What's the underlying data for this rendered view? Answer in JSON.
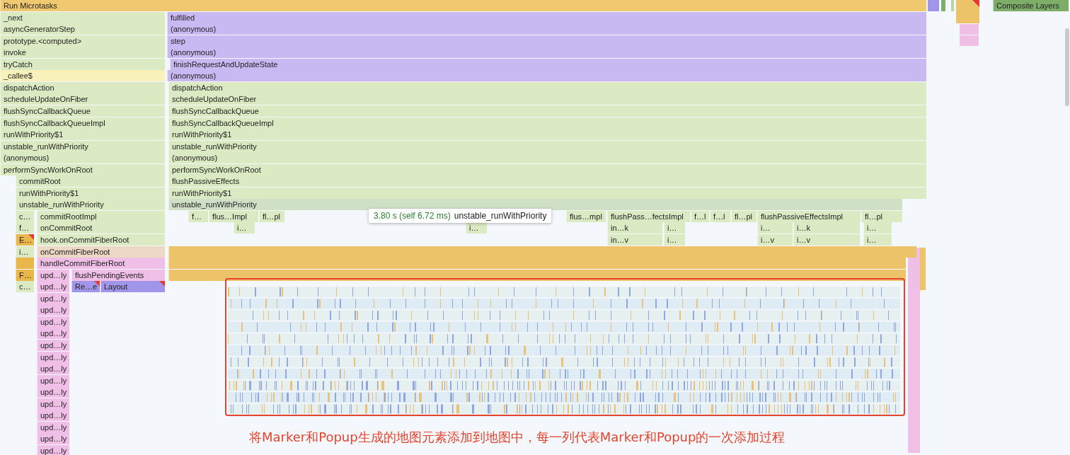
{
  "flame_chart": {
    "rows": [
      {
        "events": [
          {
            "label": "Run Microtasks",
            "color": "#f0c870",
            "warning": false
          },
          {
            "label": "Composite Layers",
            "color": "#7dad68",
            "warning": false
          }
        ]
      },
      {
        "events": [
          {
            "label": "_next",
            "color": "#dbeac2",
            "warning": false
          },
          {
            "label": "fulfilled",
            "color": "#c8b9f2",
            "warning": false
          }
        ]
      },
      {
        "events": [
          {
            "label": "asyncGeneratorStep",
            "color": "#dbeac2",
            "warning": false
          },
          {
            "label": "(anonymous)",
            "color": "#c8b9f2",
            "warning": false
          }
        ]
      },
      {
        "events": [
          {
            "label": "prototype.<computed>",
            "color": "#dbeac2",
            "warning": false
          },
          {
            "label": "step",
            "color": "#c8b9f2",
            "warning": false
          }
        ]
      },
      {
        "events": [
          {
            "label": "invoke",
            "color": "#dbeac2",
            "warning": false
          },
          {
            "label": "(anonymous)",
            "color": "#c8b9f2",
            "warning": false
          }
        ]
      },
      {
        "events": [
          {
            "label": "tryCatch",
            "color": "#dbeac2",
            "warning": false
          },
          {
            "label": "finishRequestAndUpdateState",
            "color": "#c8b9f2",
            "warning": false
          }
        ]
      },
      {
        "events": [
          {
            "label": "_callee$",
            "color": "#f8f1ba",
            "warning": false
          },
          {
            "label": "(anonymous)",
            "color": "#c8b9f2",
            "warning": false
          }
        ]
      },
      {
        "events": [
          {
            "label": "dispatchAction",
            "color": "#dbeac2",
            "warning": false
          },
          {
            "label": "dispatchAction",
            "color": "#dbeac2",
            "warning": false
          }
        ]
      },
      {
        "events": [
          {
            "label": "scheduleUpdateOnFiber",
            "color": "#dbeac2",
            "warning": false
          },
          {
            "label": "scheduleUpdateOnFiber",
            "color": "#dbeac2",
            "warning": false
          }
        ]
      },
      {
        "events": [
          {
            "label": "flushSyncCallbackQueue",
            "color": "#dbeac2",
            "warning": false
          },
          {
            "label": "flushSyncCallbackQueue",
            "color": "#dbeac2",
            "warning": false
          }
        ]
      },
      {
        "events": [
          {
            "label": "flushSyncCallbackQueueImpl",
            "color": "#dbeac2",
            "warning": false
          },
          {
            "label": "flushSyncCallbackQueueImpl",
            "color": "#dbeac2",
            "warning": false
          }
        ]
      },
      {
        "events": [
          {
            "label": "runWithPriority$1",
            "color": "#dbeac2",
            "warning": false
          },
          {
            "label": "runWithPriority$1",
            "color": "#dbeac2",
            "warning": false
          }
        ]
      },
      {
        "events": [
          {
            "label": "unstable_runWithPriority",
            "color": "#dbeac2",
            "warning": false
          },
          {
            "label": "unstable_runWithPriority",
            "color": "#dbeac2",
            "warning": false
          }
        ]
      },
      {
        "events": [
          {
            "label": "(anonymous)",
            "color": "#dbeac2",
            "warning": false
          },
          {
            "label": "(anonymous)",
            "color": "#dbeac2",
            "warning": false
          }
        ]
      },
      {
        "events": [
          {
            "label": "performSyncWorkOnRoot",
            "color": "#dbeac2",
            "warning": false
          },
          {
            "label": "performSyncWorkOnRoot",
            "color": "#dbeac2",
            "warning": false
          }
        ]
      },
      {
        "events": [
          {
            "label": "commitRoot",
            "color": "#dbeac2",
            "warning": false
          },
          {
            "label": "flushPassiveEffects",
            "color": "#dbeac2",
            "warning": false
          }
        ]
      },
      {
        "events": [
          {
            "label": "runWithPriority$1",
            "color": "#dbeac2",
            "warning": false
          },
          {
            "label": "runWithPriority$1",
            "color": "#dbeac2",
            "warning": false
          }
        ]
      },
      {
        "events": [
          {
            "label": "unstable_runWithPriority",
            "color": "#dbeac2",
            "warning": false
          },
          {
            "label": "unstable_runWithPriority",
            "color": "#cfe0c7",
            "warning": false
          }
        ]
      },
      {
        "events": [
          {
            "label": "c…",
            "color": "#dbeac2",
            "warning": false
          },
          {
            "label": "commitRootImpl",
            "color": "#dbeac2",
            "warning": false
          },
          {
            "label": "f…",
            "color": "#dbeac2",
            "warning": false
          },
          {
            "label": "flus…Impl",
            "color": "#dbeac2",
            "warning": false
          },
          {
            "label": "fl…pl",
            "color": "#dbeac2",
            "warning": false
          },
          {
            "label": "flus…mpl",
            "color": "#dbeac2",
            "warning": false
          },
          {
            "label": "flushPass…fectsImpl",
            "color": "#dbeac2",
            "warning": false
          },
          {
            "label": "f…l",
            "color": "#dbeac2",
            "warning": false
          },
          {
            "label": "f…l",
            "color": "#dbeac2",
            "warning": false
          },
          {
            "label": "fl…pl",
            "color": "#dbeac2",
            "warning": false
          },
          {
            "label": "flushPassiveEffectsImpl",
            "color": "#dbeac2",
            "warning": false
          },
          {
            "label": "fl…pl",
            "color": "#dbeac2",
            "warning": false
          }
        ]
      },
      {
        "events": [
          {
            "label": "f…",
            "color": "#dbeac2",
            "warning": false
          },
          {
            "label": "onCommitRoot",
            "color": "#dbeac2",
            "warning": false
          },
          {
            "label": "i…",
            "color": "#dbeac2",
            "warning": false
          },
          {
            "label": "i…",
            "color": "#dbeac2",
            "warning": false
          },
          {
            "label": "in…k",
            "color": "#dbeac2",
            "warning": false
          },
          {
            "label": "i…",
            "color": "#dbeac2",
            "warning": false
          },
          {
            "label": "i…",
            "color": "#dbeac2",
            "warning": false
          },
          {
            "label": "i…k",
            "color": "#dbeac2",
            "warning": false
          },
          {
            "label": "i…",
            "color": "#dbeac2",
            "warning": false
          }
        ]
      },
      {
        "events": [
          {
            "label": "E…",
            "color": "#e9b649",
            "warning": true
          },
          {
            "label": "hook.onCommitFiberRoot",
            "color": "#dbeac2",
            "warning": false
          },
          {
            "label": "in…v",
            "color": "#dbeac2",
            "warning": false
          },
          {
            "label": "i…",
            "color": "#dbeac2",
            "warning": false
          },
          {
            "label": "i…v",
            "color": "#dbeac2",
            "warning": false
          },
          {
            "label": "i…v",
            "color": "#dbeac2",
            "warning": false
          },
          {
            "label": "i…",
            "color": "#dbeac2",
            "warning": false
          }
        ]
      },
      {
        "events": [
          {
            "label": "i…",
            "color": "#dbeac2",
            "warning": false
          },
          {
            "label": "onCommitFiberRoot",
            "color": "#ecd8c4",
            "warning": false
          },
          {
            "color": "#edc36a",
            "warning": false
          }
        ]
      },
      {
        "events": [
          {
            "color": "#e9b649",
            "warning": false
          },
          {
            "label": "handleCommitFiberRoot",
            "color": "#f0bfe8",
            "warning": false
          },
          {
            "color": "#edc36a",
            "warning": false
          }
        ]
      },
      {
        "events": [
          {
            "label": "F…",
            "color": "#e9b649",
            "warning": false
          },
          {
            "label": "upd…ly",
            "color": "#f0bfe8",
            "warning": false
          },
          {
            "label": "flushPendingEvents",
            "color": "#f0bfe8",
            "warning": false
          },
          {
            "color": "#edc36a",
            "warning": false
          }
        ]
      },
      {
        "events": [
          {
            "label": "c…",
            "color": "#dbeac2",
            "warning": false
          },
          {
            "label": "upd…ly",
            "color": "#f0bfe8",
            "warning": false
          },
          {
            "label": "Re…e",
            "color": "#a195ea",
            "warning": true
          },
          {
            "label": "Layout",
            "color": "#a195ea",
            "warning": true
          }
        ]
      },
      {
        "events": [
          {
            "label": "upd…ly",
            "color": "#f0bfe8",
            "warning": false
          }
        ]
      },
      {
        "events": [
          {
            "label": "upd…ly",
            "color": "#f0bfe8",
            "warning": false
          }
        ]
      },
      {
        "events": [
          {
            "label": "upd…ly",
            "color": "#f0bfe8",
            "warning": false
          }
        ]
      },
      {
        "events": [
          {
            "label": "upd…ly",
            "color": "#f0bfe8",
            "warning": false
          }
        ]
      },
      {
        "events": [
          {
            "label": "upd…ly",
            "color": "#f0bfe8",
            "warning": false
          }
        ]
      },
      {
        "events": [
          {
            "label": "upd…ly",
            "color": "#f0bfe8",
            "warning": false
          }
        ]
      },
      {
        "events": [
          {
            "label": "upd…ly",
            "color": "#f0bfe8",
            "warning": false
          }
        ]
      },
      {
        "events": [
          {
            "label": "upd…ly",
            "color": "#f0bfe8",
            "warning": false
          }
        ]
      },
      {
        "events": [
          {
            "label": "upd…ly",
            "color": "#f0bfe8",
            "warning": false
          }
        ]
      },
      {
        "events": [
          {
            "label": "upd…ly",
            "color": "#f0bfe8",
            "warning": false
          }
        ]
      },
      {
        "events": [
          {
            "label": "upd…ly",
            "color": "#f0bfe8",
            "warning": false
          }
        ]
      },
      {
        "events": [
          {
            "label": "upd…ly",
            "color": "#f0bfe8",
            "warning": false
          }
        ]
      },
      {
        "events": [
          {
            "label": "upd…ly",
            "color": "#f0bfe8",
            "warning": false
          }
        ]
      },
      {
        "events": [
          {
            "label": "upd…ly",
            "color": "#f0bfe8",
            "warning": false
          }
        ]
      }
    ]
  },
  "tooltip": {
    "time": "3.80 s (self 6.72 ms)",
    "name": "unstable_runWithPriority"
  },
  "annotation": "将Marker和Popup生成的地图元素添加到地图中，每一列代表Marker和Popup的一次添加过程"
}
